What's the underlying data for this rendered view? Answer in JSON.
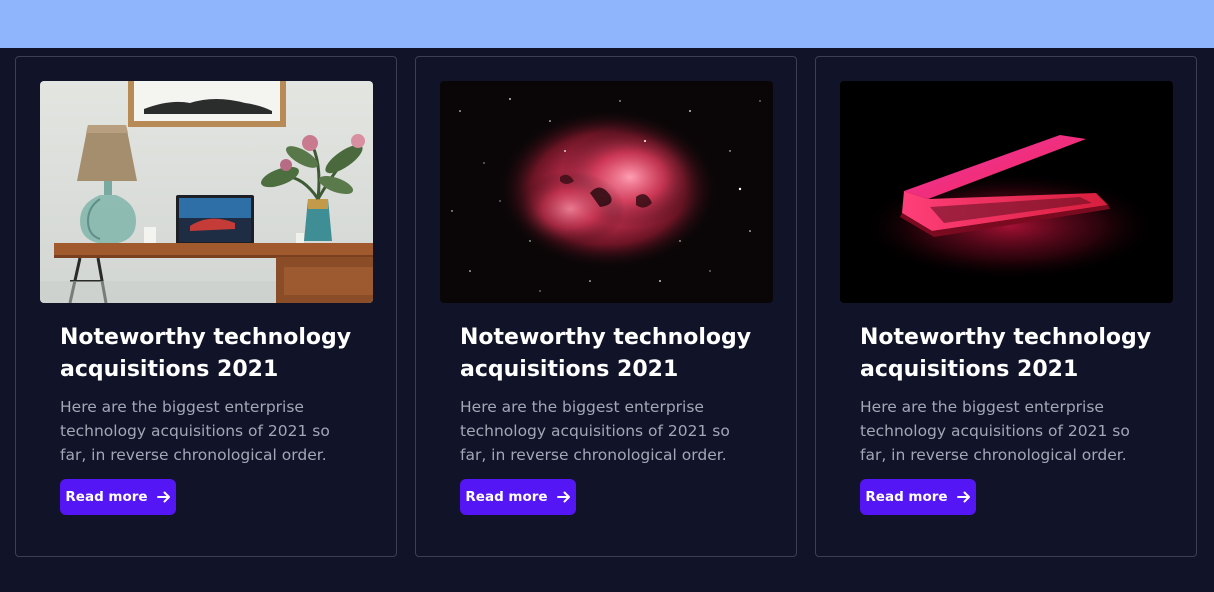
{
  "cards": [
    {
      "image_name": "desk-lamp-laptop-photo",
      "title": "Noteworthy technology acquisitions 2021",
      "description": "Here are the biggest enterprise technology acquisitions of 2021 so far, in reverse chronological order.",
      "button_label": "Read more",
      "button_icon": "arrow-right-icon"
    },
    {
      "image_name": "red-nebula-photo",
      "title": "Noteworthy technology acquisitions 2021",
      "description": "Here are the biggest enterprise technology acquisitions of 2021 so far, in reverse chronological order.",
      "button_label": "Read more",
      "button_icon": "arrow-right-icon"
    },
    {
      "image_name": "glowing-laptop-photo",
      "title": "Noteworthy technology acquisitions 2021",
      "description": "Here are the biggest enterprise technology acquisitions of 2021 so far, in reverse chronological order.",
      "button_label": "Read more",
      "button_icon": "arrow-right-icon"
    }
  ],
  "colors": {
    "top_band": "#8fb6fd",
    "background": "#111428",
    "card_border": "#3a3f52",
    "button": "#5516f5",
    "title": "#ffffff",
    "description": "#a3a6b5"
  }
}
